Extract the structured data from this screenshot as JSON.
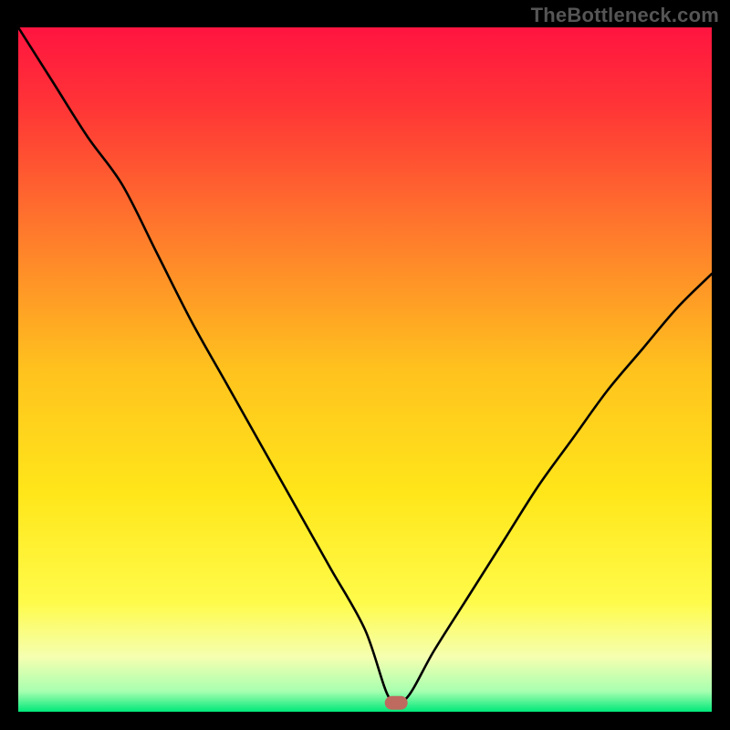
{
  "watermark": "TheBottleneck.com",
  "chart_data": {
    "type": "line",
    "title": "",
    "xlabel": "",
    "ylabel": "",
    "xlim": [
      0,
      100
    ],
    "ylim": [
      0,
      100
    ],
    "grid": false,
    "legend": false,
    "background": "red-yellow-green vertical gradient (bottleneck severity heatmap)",
    "note": "Axes are unlabeled in the source image; x/y are normalized 0-100. Values are estimated from the rendered curve and color bands.",
    "series": [
      {
        "name": "bottleneck-curve",
        "x": [
          0,
          5,
          10,
          15,
          20,
          25,
          30,
          35,
          40,
          45,
          50,
          53.5,
          56,
          60,
          65,
          70,
          75,
          80,
          85,
          90,
          95,
          100
        ],
        "y": [
          100,
          92,
          84,
          77,
          67,
          57,
          48,
          39,
          30,
          21,
          12,
          2,
          2,
          9,
          17,
          25,
          33,
          40,
          47,
          53,
          59,
          64
        ]
      }
    ],
    "gradient_stops": [
      {
        "pct": 0,
        "color": "#ff1440"
      },
      {
        "pct": 12,
        "color": "#ff3636"
      },
      {
        "pct": 30,
        "color": "#ff7a2c"
      },
      {
        "pct": 50,
        "color": "#ffc21e"
      },
      {
        "pct": 68,
        "color": "#ffe61a"
      },
      {
        "pct": 84,
        "color": "#fffb4a"
      },
      {
        "pct": 92,
        "color": "#f5ffb0"
      },
      {
        "pct": 97,
        "color": "#a8ffb0"
      },
      {
        "pct": 100,
        "color": "#00e87a"
      }
    ],
    "marker": {
      "name": "optimal-point",
      "x": 54.5,
      "y": 1.3,
      "color": "#bf6a5f",
      "shape": "rounded-rect"
    }
  }
}
